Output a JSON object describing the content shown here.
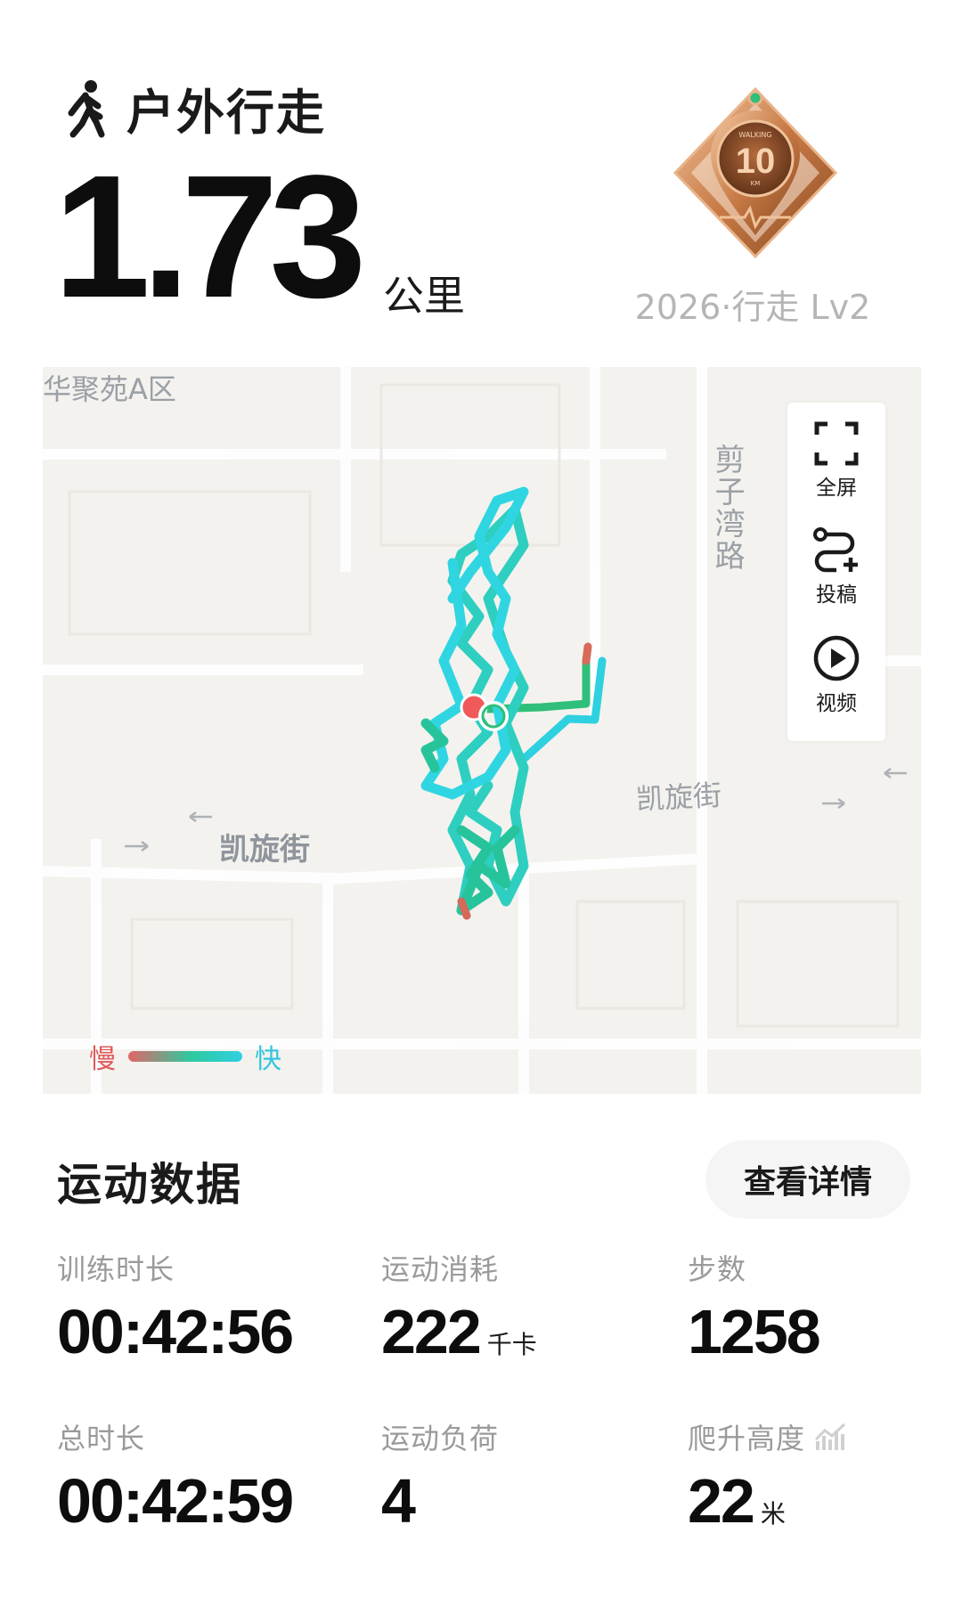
{
  "header": {
    "activity_icon": "walking-person-icon",
    "activity_type": "户外行走",
    "distance": "1.73",
    "distance_unit": "公里",
    "badge": {
      "icon": "walking-medal-icon",
      "medal_top_text": "WALKING",
      "medal_number": "10",
      "medal_unit": "KM",
      "caption": "2026·行走 Lv2"
    }
  },
  "map": {
    "labels": {
      "area": "华聚苑A区",
      "road_vertical": "剪子湾路",
      "street_left": "凯旋街",
      "street_right": "凯旋街"
    },
    "toolbar": {
      "fullscreen": {
        "icon": "fullscreen-icon",
        "label": "全屏"
      },
      "submit": {
        "icon": "route-add-icon",
        "label": "投稿"
      },
      "video": {
        "icon": "play-circle-icon",
        "label": "视频"
      }
    },
    "legend": {
      "slow": "慢",
      "fast": "快"
    },
    "colors": {
      "slow": "#e06666",
      "mid": "#2ec9a0",
      "fast": "#2fd0e0",
      "start_marker": "#f05a5a",
      "end_marker": "#2fbf7a"
    }
  },
  "stats": {
    "title": "运动数据",
    "details_button": "查看详情",
    "items": [
      {
        "label": "训练时长",
        "value": "00:42:56",
        "unit": ""
      },
      {
        "label": "运动消耗",
        "value": "222",
        "unit": "千卡"
      },
      {
        "label": "步数",
        "value": "1258",
        "unit": ""
      },
      {
        "label": "总时长",
        "value": "00:42:59",
        "unit": ""
      },
      {
        "label": "运动负荷",
        "value": "4",
        "unit": ""
      },
      {
        "label": "爬升高度",
        "value": "22",
        "unit": "米",
        "icon": "elevation-chart-icon"
      }
    ]
  }
}
